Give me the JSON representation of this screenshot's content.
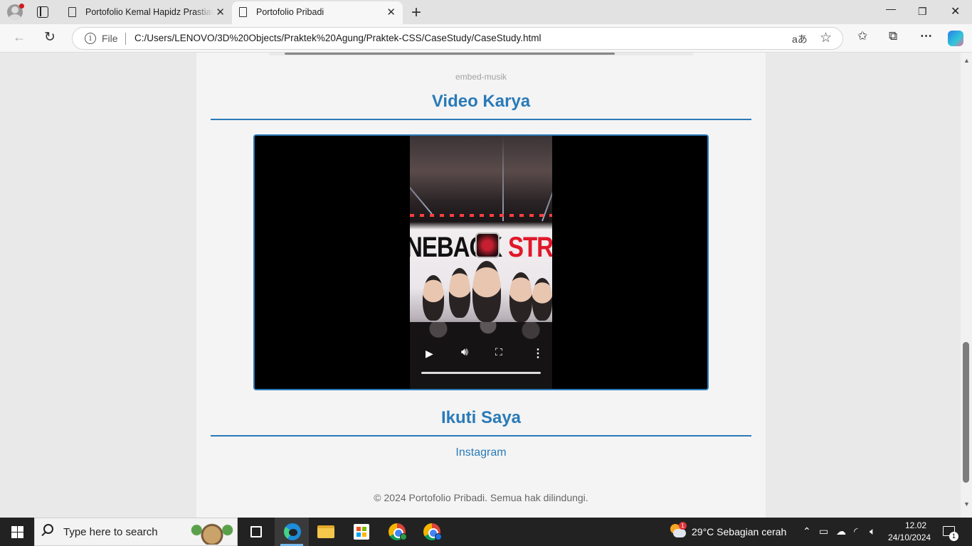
{
  "browser": {
    "tabs": [
      {
        "title": "Portofolio Kemal Hapidz Prastiaw",
        "active": false
      },
      {
        "title": "Portofolio Pribadi",
        "active": true
      }
    ],
    "address": {
      "scheme_label": "File",
      "url": "C:/Users/LENOVO/3D%20Objects/Praktek%20Agung/Praktek-CSS/CaseStudy/CaseStudy.html"
    }
  },
  "page": {
    "media_caption": "embed-musik",
    "video_heading": "Video Karya",
    "follow_heading": "Ikuti Saya",
    "instagram_link": "Instagram",
    "footer": "© 2024 Portofolio Pribadi. Semua hak dilindungi.",
    "accent_color": "#2a7ab8",
    "video_still_text": {
      "left": "NEBACK",
      "right": "STRO"
    }
  },
  "taskbar": {
    "search_placeholder": "Type here to search",
    "weather_badge": "1",
    "weather": "29°C  Sebagian cerah",
    "time": "12.02",
    "date": "24/10/2024",
    "notification_count": "1"
  },
  "icons": [
    "profile-icon",
    "tab-actions-icon",
    "document-icon",
    "close-icon",
    "new-tab-icon",
    "minimize-icon",
    "restore-icon",
    "back-icon",
    "refresh-icon",
    "info-icon",
    "read-aloud-icon",
    "favorite-star-icon",
    "favorites-icon",
    "collections-icon",
    "more-icon",
    "copilot-icon",
    "play-icon",
    "volume-icon",
    "fullscreen-icon",
    "kebab-icon",
    "windows-logo-icon",
    "search-icon",
    "task-view-icon",
    "edge-icon",
    "file-explorer-icon",
    "store-icon",
    "chrome-icon",
    "weather-icon",
    "wifi-icon",
    "volume-tray-icon",
    "notification-icon"
  ]
}
